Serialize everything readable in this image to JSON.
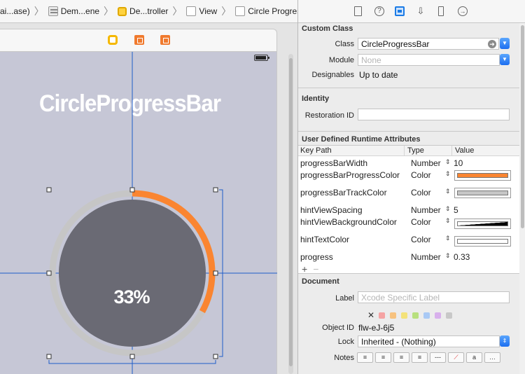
{
  "breadcrumb": {
    "items": [
      {
        "label": "ai...ase)",
        "icon": "folder-icon"
      },
      {
        "label": "Dem...ene",
        "icon": "storyboard-icon"
      },
      {
        "label": "De...troller",
        "icon": "view-controller-icon"
      },
      {
        "label": "View",
        "icon": "view-icon"
      },
      {
        "label": "Circle Progress Bar",
        "icon": "view-icon"
      }
    ]
  },
  "canvas": {
    "app_title": "CircleProgressBar",
    "progress_text": "33%",
    "progress_value": 0.33,
    "colors": {
      "progress": "#fa8531",
      "track": "#c6c6c6",
      "background": "#6a6a74",
      "device_bg": "#c6c7d6",
      "guide": "#1e5cc8"
    }
  },
  "inspector": {
    "tabs": [
      "file-inspector-icon",
      "quick-help-icon",
      "identity-inspector-icon",
      "attributes-inspector-icon",
      "size-inspector-icon",
      "connections-inspector-icon"
    ],
    "custom_class": {
      "title": "Custom Class",
      "class_label": "Class",
      "class_value": "CircleProgressBar",
      "module_label": "Module",
      "module_placeholder": "None",
      "designables_label": "Designables",
      "designables_value": "Up to date"
    },
    "identity": {
      "title": "Identity",
      "restoration_label": "Restoration ID",
      "restoration_value": ""
    },
    "udra": {
      "title": "User Defined Runtime Attributes",
      "headers": {
        "key": "Key Path",
        "type": "Type",
        "value": "Value"
      },
      "rows": [
        {
          "key": "progressBarWidth",
          "type": "Number",
          "value": "10"
        },
        {
          "key": "progressBarProgressColor",
          "type": "Color",
          "color": "#fa8531"
        },
        {
          "key": "progressBarTrackColor",
          "type": "Color",
          "color": "#c6c6c6"
        },
        {
          "key": "hintViewSpacing",
          "type": "Number",
          "value": "5"
        },
        {
          "key": "hintViewBackgroundColor",
          "type": "Color",
          "color": "#000000"
        },
        {
          "key": "hintTextColor",
          "type": "Color",
          "color": "#ffffff"
        },
        {
          "key": "progress",
          "type": "Number",
          "value": "0.33"
        }
      ],
      "add_label": "+",
      "remove_label": "−"
    },
    "document": {
      "title": "Document",
      "label_label": "Label",
      "label_placeholder": "Xcode Specific Label",
      "clear_label": "✕",
      "label_colors": [
        "#f5a3a3",
        "#f7c27f",
        "#f4e27a",
        "#b8e07e",
        "#a9c9f5",
        "#d8b0ec",
        "#c8c8c8"
      ],
      "object_id_label": "Object ID",
      "object_id_value": "flw-eJ-6j5",
      "lock_label": "Lock",
      "lock_value": "Inherited - (Nothing)",
      "notes_label": "Notes"
    }
  }
}
